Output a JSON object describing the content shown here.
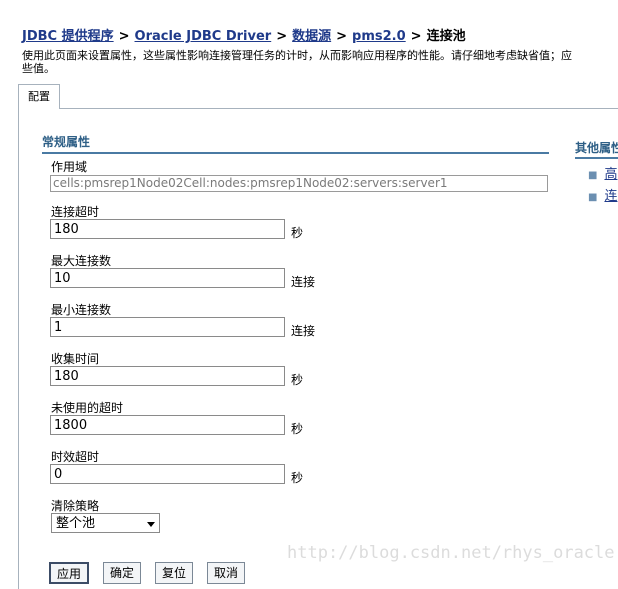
{
  "breadcrumb": [
    {
      "label": "JDBC 提供程序"
    },
    {
      "label": "Oracle JDBC Driver"
    },
    {
      "label": "数据源"
    },
    {
      "label": "pms2.0"
    }
  ],
  "breadcrumb_separator": ">",
  "breadcrumb_current": "连接池",
  "description": {
    "line1": "使用此页面来设置属性，这些属性影响连接管理任务的计时，从而影响应用程序的性能。请仔细地考虑缺省值；应",
    "line2": "些值。"
  },
  "tab": {
    "label": "配置"
  },
  "general": {
    "title": "常规属性",
    "scope": {
      "label": "作用域",
      "value": "cells:pmsrep1Node02Cell:nodes:pmsrep1Node02:servers:server1"
    },
    "connection_timeout": {
      "label": "连接超时",
      "value": "180",
      "unit": "秒"
    },
    "max_connections": {
      "label": "最大连接数",
      "value": "10",
      "unit": "连接"
    },
    "min_connections": {
      "label": "最小连接数",
      "value": "1",
      "unit": "连接"
    },
    "reap_time": {
      "label": "收集时间",
      "value": "180",
      "unit": "秒"
    },
    "unused_timeout": {
      "label": "未使用的超时",
      "value": "1800",
      "unit": "秒"
    },
    "aged_timeout": {
      "label": "时效超时",
      "value": "0",
      "unit": "秒"
    },
    "purge_policy": {
      "label": "清除策略",
      "value": "整个池"
    }
  },
  "other": {
    "title": "其他属性",
    "items": [
      {
        "label": "高"
      },
      {
        "label": "连"
      }
    ]
  },
  "buttons": {
    "apply": "应用",
    "ok": "确定",
    "reset": "复位",
    "cancel": "取消"
  },
  "watermark": "http://blog.csdn.net/rhys_oracle",
  "colors": {
    "link": "#1f3a8a",
    "section_title": "#2e5f86",
    "rule": "#4a7aa3",
    "tab_border": "#a7b2bd"
  }
}
